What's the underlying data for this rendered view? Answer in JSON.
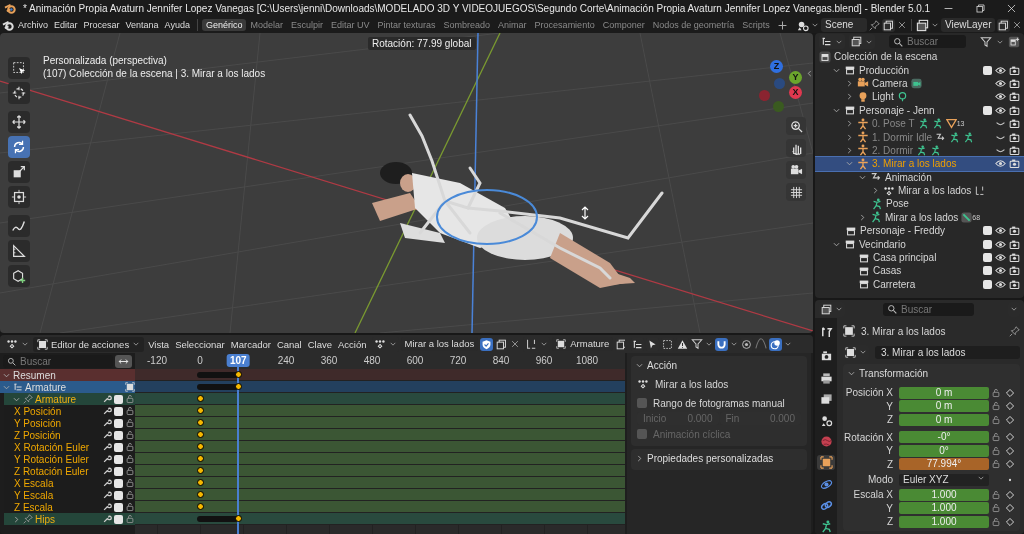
{
  "window": {
    "title": "* Animación Propia Avaturn Jennifer Lopez Vanegas [C:\\Users\\jenni\\Downloads\\MODELADO 3D Y VIDEOJUEGOS\\Segundo Corte\\Animación Propia Avaturn Jennifer Lopez Vanegas.blend] - Blender 5.0.1"
  },
  "menus": [
    "Archivo",
    "Editar",
    "Procesar",
    "Ventana",
    "Ayuda"
  ],
  "workspaces": [
    {
      "label": "Genérico",
      "selected": true
    },
    {
      "label": "Modelar",
      "selected": false
    },
    {
      "label": "Esculpir",
      "selected": false
    },
    {
      "label": "Editar UV",
      "selected": false
    },
    {
      "label": "Pintar texturas",
      "selected": false
    },
    {
      "label": "Sombreado",
      "selected": false
    },
    {
      "label": "Animar",
      "selected": false
    },
    {
      "label": "Procesamiento",
      "selected": false
    },
    {
      "label": "Componer",
      "selected": false
    },
    {
      "label": "Nodos de geometría",
      "selected": false
    },
    {
      "label": "Scripts",
      "selected": false
    }
  ],
  "scene": "Scene",
  "view_layer": "ViewLayer",
  "viewport": {
    "header_info": "Rotación: 77.99 global",
    "view_name": "Personalizada (perspectiva)",
    "context": "(107) Colección de la escena | 3. Mirar a los lados",
    "tools": [
      {
        "kind": "select",
        "selected": false
      },
      {
        "kind": "cursor",
        "selected": false
      },
      {
        "kind": "move",
        "selected": false
      },
      {
        "kind": "rotate",
        "selected": true
      },
      {
        "kind": "scale",
        "selected": false
      },
      {
        "kind": "transform",
        "selected": false
      },
      {
        "kind": "annotate",
        "selected": false
      },
      {
        "kind": "measure",
        "selected": false
      },
      {
        "kind": "add",
        "selected": false
      }
    ],
    "gizmo": [
      {
        "label": "Z",
        "color": "#2f6fe0"
      },
      {
        "label": "Y",
        "color": "#6ba52c"
      },
      {
        "label": "X",
        "color": "#e0384f"
      }
    ]
  },
  "outliner": {
    "search": {
      "placeholder": "Buscar"
    },
    "tree": [
      {
        "name": "Colección de la escena",
        "kind": "scene-collection",
        "selected": false,
        "children": [
          {
            "name": "Producción",
            "kind": "collection",
            "selected": false,
            "expanded": true,
            "included": true,
            "visible": true,
            "children": [
              {
                "name": "Camera",
                "kind": "camera",
                "selected": false,
                "expanded": false,
                "visible": true,
                "extras": [
                  {
                    "kind": "camera-data"
                  }
                ]
              },
              {
                "name": "Light",
                "kind": "light",
                "selected": false,
                "expanded": false,
                "visible": true,
                "extras": [
                  {
                    "kind": "light-data"
                  }
                ]
              }
            ]
          },
          {
            "name": "Personaje - Jenn",
            "kind": "collection",
            "selected": false,
            "expanded": true,
            "included": true,
            "visible": true,
            "children": [
              {
                "name": "0. Pose T",
                "kind": "armature",
                "selected": false,
                "expanded": false,
                "visible": false,
                "extras": [
                  {
                    "kind": "pose"
                  },
                  {
                    "kind": "armature-data"
                  },
                  {
                    "kind": "mesh",
                    "count": "13"
                  }
                ]
              },
              {
                "name": "1. Dormir Idle",
                "kind": "armature",
                "selected": false,
                "expanded": false,
                "visible": false,
                "extras": [
                  {
                    "kind": "animation"
                  },
                  {
                    "kind": "pose"
                  },
                  {
                    "kind": "armature-data"
                  }
                ]
              },
              {
                "name": "2. Dormir",
                "kind": "armature",
                "selected": false,
                "expanded": false,
                "visible": false,
                "extras": [
                  {
                    "kind": "pose"
                  },
                  {
                    "kind": "armature-data"
                  }
                ]
              },
              {
                "name": "3. Mirar a los lados",
                "kind": "armature",
                "selected": true,
                "expanded": true,
                "visible": true,
                "children": [
                  {
                    "name": "Animación",
                    "kind": "animation",
                    "selected": false,
                    "expanded": true,
                    "children": [
                      {
                        "name": "Mirar a los lados",
                        "kind": "action",
                        "selected": false,
                        "expanded": false,
                        "extras": [
                          {
                            "kind": "slot"
                          }
                        ]
                      }
                    ]
                  },
                  {
                    "name": "Pose",
                    "kind": "pose",
                    "selected": false
                  },
                  {
                    "name": "Mirar a los lados",
                    "kind": "armature-data",
                    "selected": false,
                    "expanded": false,
                    "extras": [
                      {
                        "kind": "bones",
                        "count": "68"
                      }
                    ]
                  }
                ]
              }
            ]
          },
          {
            "name": "Personaje - Freddy",
            "kind": "collection",
            "selected": false,
            "included": true,
            "visible": true
          },
          {
            "name": "Vecindario",
            "kind": "collection",
            "selected": false,
            "expanded": true,
            "included": true,
            "visible": true,
            "children": [
              {
                "name": "Casa principal",
                "kind": "collection",
                "selected": false,
                "included": true,
                "visible": true
              },
              {
                "name": "Casas",
                "kind": "collection",
                "selected": false,
                "included": true,
                "visible": true
              },
              {
                "name": "Carretera",
                "kind": "collection",
                "selected": false,
                "included": true,
                "visible": true
              }
            ]
          }
        ]
      }
    ]
  },
  "action_editor": {
    "mode": "Editor de acciones",
    "menus": [
      "Vista",
      "Seleccionar",
      "Marcador",
      "Canal",
      "Clave",
      "Acción"
    ],
    "action": "Mirar a los lados",
    "fake_user": true,
    "slot": "Armature",
    "search": {
      "placeholder": "Buscar"
    },
    "ruler": [
      "-120",
      "0",
      "240",
      "360",
      "480",
      "600",
      "720",
      "840",
      "960",
      "1080"
    ],
    "current_frame": "107",
    "channels": [
      {
        "kind": "summary",
        "label": "Resumen",
        "expanded": true,
        "hold": true
      },
      {
        "kind": "object",
        "label": "Armature",
        "expanded": true,
        "hold": true
      },
      {
        "kind": "group",
        "label": "Armature",
        "expanded": true,
        "hold": false,
        "checked": true
      },
      {
        "kind": "fcurve",
        "label": "X Posición",
        "hold": false,
        "checked": true
      },
      {
        "kind": "fcurve",
        "label": "Y Posición",
        "hold": false,
        "checked": true
      },
      {
        "kind": "fcurve",
        "label": "Z Posición",
        "hold": false,
        "checked": true
      },
      {
        "kind": "fcurve",
        "label": "X Rotación Euler",
        "hold": false,
        "checked": true
      },
      {
        "kind": "fcurve",
        "label": "Y Rotación Euler",
        "hold": false,
        "checked": true
      },
      {
        "kind": "fcurve",
        "label": "Z Rotación Euler",
        "hold": false,
        "checked": true
      },
      {
        "kind": "fcurve",
        "label": "X Escala",
        "hold": false,
        "checked": true
      },
      {
        "kind": "fcurve",
        "label": "Y Escala",
        "hold": false,
        "checked": true
      },
      {
        "kind": "fcurve",
        "label": "Z Escala",
        "hold": false,
        "checked": true
      },
      {
        "kind": "group",
        "label": "Hips",
        "expanded": false,
        "hold": true,
        "checked": true
      }
    ],
    "sidebar": {
      "panel": {
        "title": "Acción",
        "expanded": true
      },
      "action": "Mirar a los lados",
      "manual_range": {
        "label": "Rango de fotogramas manual",
        "checked": false
      },
      "start": {
        "label": "Inicio",
        "value": "0.000",
        "disabled": true
      },
      "end": {
        "label": "Fin",
        "value": "0.000",
        "disabled": true
      },
      "cyclic": {
        "label": "Animación cíclica",
        "checked": false,
        "disabled": true
      },
      "custom_props": {
        "title": "Propiedades personalizadas",
        "expanded": false
      }
    }
  },
  "properties": {
    "search": {
      "placeholder": "Buscar"
    },
    "tabs": [
      {
        "kind": "tool",
        "selected": false
      },
      {
        "kind": "render",
        "selected": false
      },
      {
        "kind": "output",
        "selected": false
      },
      {
        "kind": "view-layer",
        "selected": false
      },
      {
        "kind": "scene",
        "selected": false
      },
      {
        "kind": "world",
        "selected": false
      },
      {
        "kind": "object",
        "selected": true
      },
      {
        "kind": "physics",
        "selected": false
      },
      {
        "kind": "constraints",
        "selected": false
      },
      {
        "kind": "armature-data",
        "selected": false
      }
    ],
    "object_name": "3. Mirar a los lados",
    "datablock": "3. Mirar a los lados",
    "panel": {
      "title": "Transformación",
      "expanded": true
    },
    "location": [
      {
        "label": "Posición X",
        "value": "0 m",
        "kind": "keyed"
      },
      {
        "label": "Y",
        "value": "0 m",
        "kind": "keyed"
      },
      {
        "label": "Z",
        "value": "0 m",
        "kind": "keyed"
      }
    ],
    "rotation": [
      {
        "label": "Rotación X",
        "value": "-0°",
        "kind": "keyed"
      },
      {
        "label": "Y",
        "value": "0°",
        "kind": "keyed"
      },
      {
        "label": "Z",
        "value": "77.994°",
        "kind": "changed"
      }
    ],
    "mode": {
      "label": "Modo",
      "value": "Euler XYZ"
    },
    "scale": [
      {
        "label": "Escala X",
        "value": "1.000",
        "kind": "keyed"
      },
      {
        "label": "Y",
        "value": "1.000",
        "kind": "keyed"
      },
      {
        "label": "Z",
        "value": "1.000",
        "kind": "keyed"
      }
    ]
  }
}
